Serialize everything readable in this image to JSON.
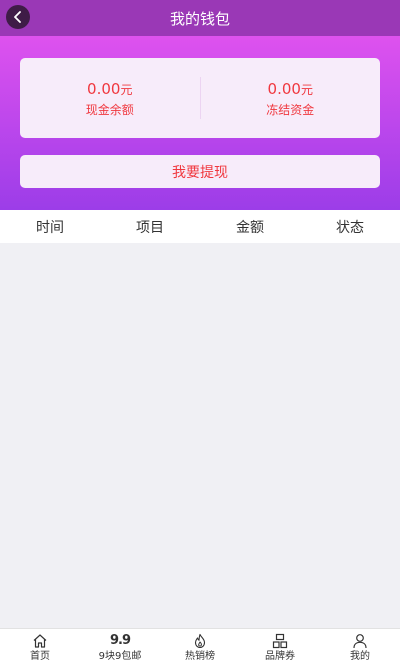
{
  "header": {
    "title": "我的钱包"
  },
  "balances": [
    {
      "amount": "0.00",
      "unit": "元",
      "label": "现金余额"
    },
    {
      "amount": "0.00",
      "unit": "元",
      "label": "冻结资金"
    }
  ],
  "withdraw_label": "我要提现",
  "table": {
    "columns": [
      "时间",
      "项目",
      "金额",
      "状态"
    ]
  },
  "tabbar": {
    "items": [
      {
        "label": "首页",
        "icon": "home-icon"
      },
      {
        "label": "9块9包邮",
        "icon": "nine-nine-icon",
        "icon_text": "9.9"
      },
      {
        "label": "热销榜",
        "icon": "flame-icon"
      },
      {
        "label": "品牌券",
        "icon": "brand-icon"
      },
      {
        "label": "我的",
        "icon": "user-icon"
      }
    ]
  },
  "colors": {
    "header_bg": "#9a38b6",
    "accent_red": "#f0383f",
    "card_bg": "#f7ecfa"
  }
}
